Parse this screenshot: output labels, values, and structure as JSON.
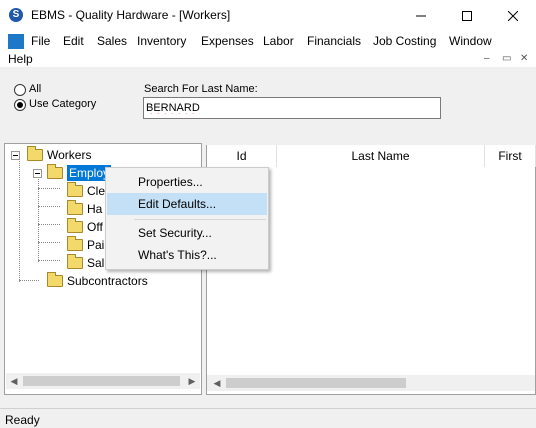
{
  "window": {
    "title": "EBMS - Quality Hardware - [Workers]"
  },
  "menu": {
    "items": [
      "File",
      "Edit",
      "Sales",
      "Inventory",
      "Expenses",
      "Labor",
      "Financials",
      "Job Costing",
      "Window",
      "Help"
    ],
    "mdi_controls": [
      "–",
      "▭",
      "✕"
    ]
  },
  "filter": {
    "radio_all": "All",
    "radio_category": "Use Category",
    "selected": "Use Category",
    "search_label": "Search For Last Name:",
    "search_value": "BERNARD"
  },
  "tree": {
    "root": "Workers",
    "selected": "Employ",
    "children": [
      "Cle",
      "Ha",
      "Off",
      "Pai",
      "Sal"
    ],
    "sibling": "Subcontractors"
  },
  "list": {
    "columns": [
      "Id",
      "Last Name",
      "First"
    ]
  },
  "context_menu": {
    "items": [
      "Properties...",
      "Edit Defaults...",
      "Set Security...",
      "What's This?..."
    ],
    "highlighted": "Edit Defaults..."
  },
  "status": {
    "text": "Ready"
  },
  "colors": {
    "selection": "#0078d7",
    "menu_hover": "#c4e0f7",
    "folder": "#f3d96a"
  }
}
